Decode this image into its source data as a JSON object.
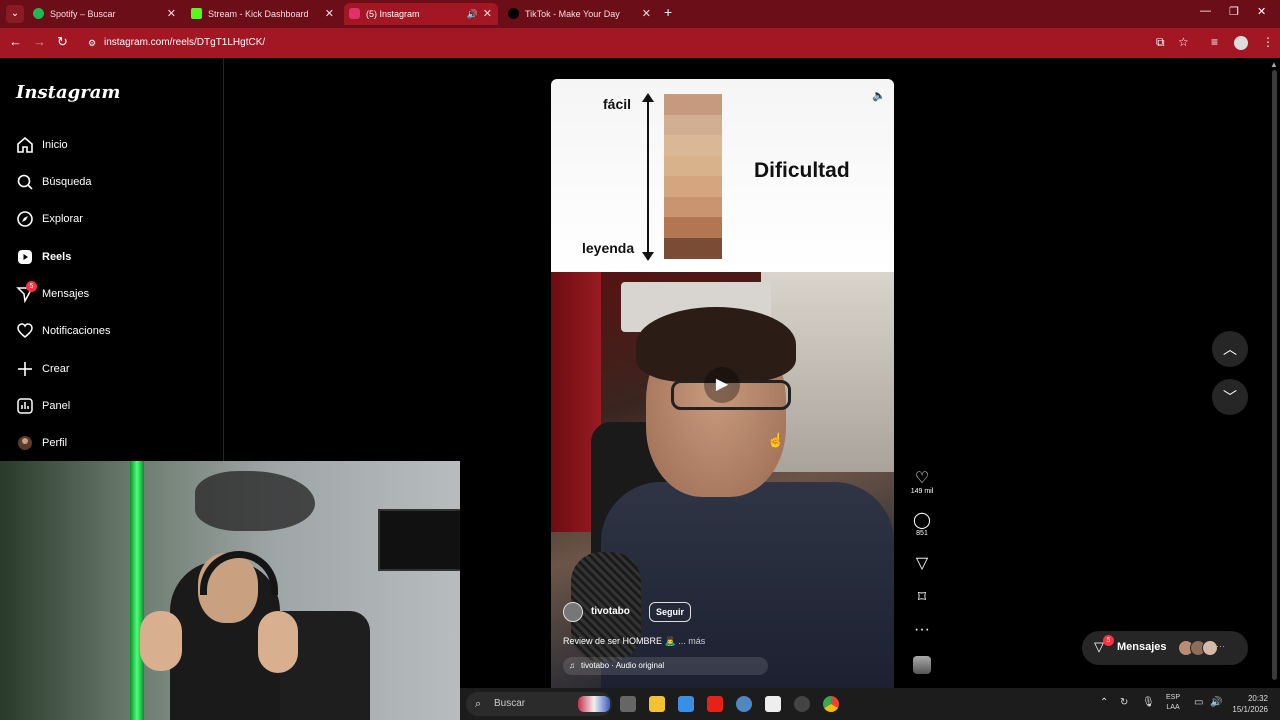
{
  "browser": {
    "tabs": [
      {
        "title": "Spotify – Buscar",
        "color": "#1db954"
      },
      {
        "title": "Stream - Kick Dashboard",
        "color": "#53fc18"
      },
      {
        "title": "(5) Instagram",
        "color": "#e1306c",
        "active": true
      },
      {
        "title": "TikTok - Make Your Day",
        "color": "#000000"
      }
    ],
    "url": "instagram.com/reels/DTgT1LHgtCK/"
  },
  "instagram": {
    "logo": "Instagram",
    "nav": [
      {
        "label": "Inicio",
        "icon": "home-icon"
      },
      {
        "label": "Búsqueda",
        "icon": "search-icon"
      },
      {
        "label": "Explorar",
        "icon": "compass-icon"
      },
      {
        "label": "Reels",
        "icon": "reels-icon",
        "active": true
      },
      {
        "label": "Mensajes",
        "icon": "messenger-icon",
        "badge": "5"
      },
      {
        "label": "Notificaciones",
        "icon": "heart-icon"
      },
      {
        "label": "Crear",
        "icon": "plus-icon"
      },
      {
        "label": "Panel",
        "icon": "chart-icon"
      },
      {
        "label": "Perfil",
        "icon": "avatar-icon"
      }
    ],
    "reel": {
      "overlay": {
        "easy_label": "fácil",
        "hard_label": "leyenda",
        "title": "Dificultad",
        "swatches": [
          "#c59a7f",
          "#d2ae93",
          "#d9b896",
          "#d8b28a",
          "#d4a57e",
          "#c99470",
          "#b37652",
          "#7a4c36"
        ]
      },
      "author": "tivotabo",
      "follow_label": "Seguir",
      "caption": "Review de ser HOMBRE 🙇‍♂️",
      "more_label": "... más",
      "audio": "tivotabo · Audio original",
      "likes": "149 mil",
      "comments": "851"
    },
    "messages_pill": {
      "label": "Mensajes",
      "badge": "5"
    }
  },
  "taskbar": {
    "search_placeholder": "Buscar",
    "lang_top": "ESP",
    "lang_bottom": "LAA",
    "time": "20:32",
    "date": "15/1/2026"
  }
}
